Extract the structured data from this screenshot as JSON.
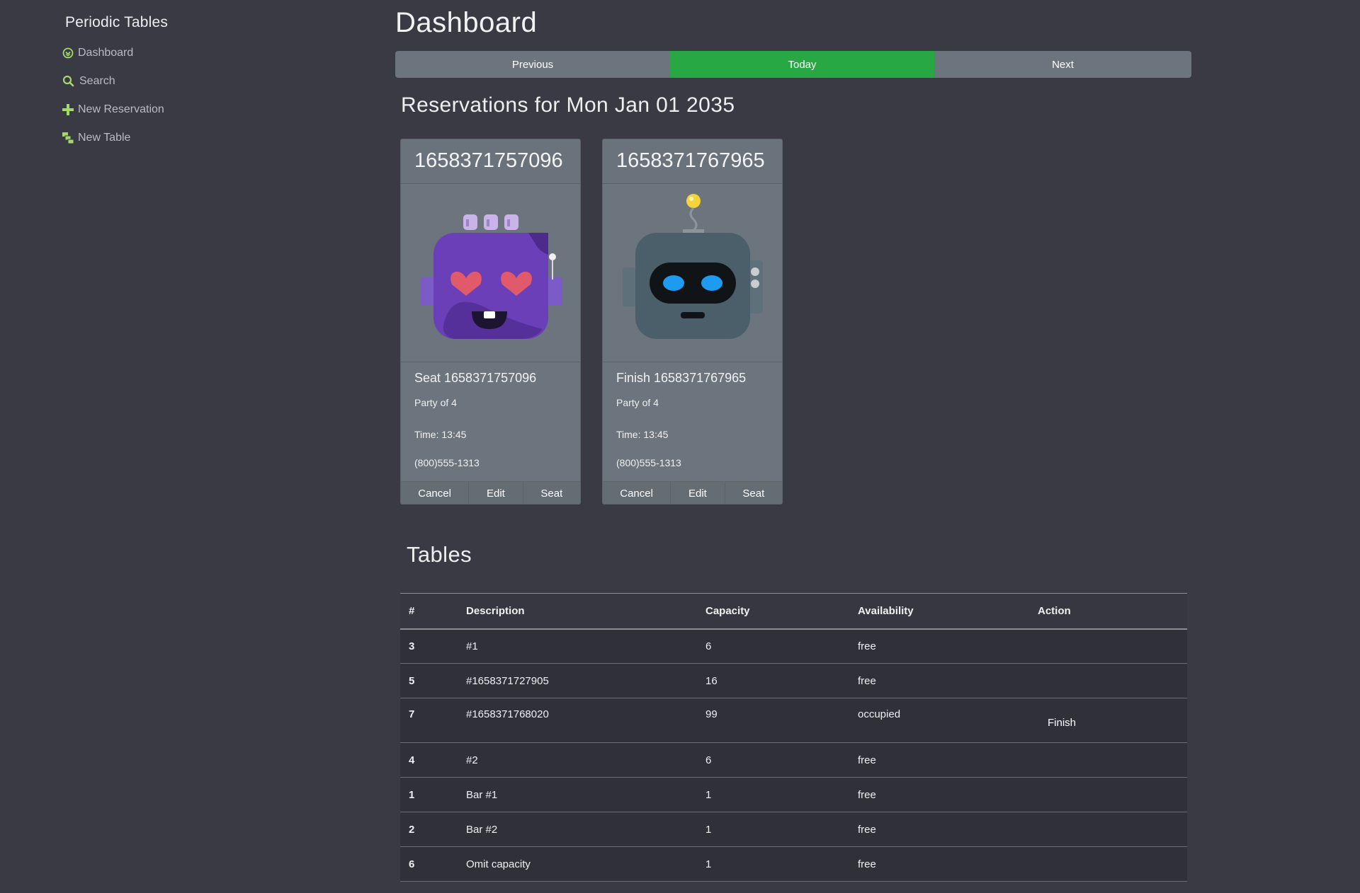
{
  "sidebar": {
    "brand": "Periodic Tables",
    "items": [
      {
        "label": "Dashboard",
        "icon": "dashboard-icon"
      },
      {
        "label": "Search",
        "icon": "search-icon"
      },
      {
        "label": "New Reservation",
        "icon": "plus-icon"
      },
      {
        "label": "New Table",
        "icon": "layers-icon"
      }
    ],
    "icon_color": "#a3d96b"
  },
  "main": {
    "title": "Dashboard",
    "date_nav": {
      "previous": "Previous",
      "today": "Today",
      "next": "Next"
    },
    "reservations_title": "Reservations for Mon Jan 01 2035",
    "reservations": [
      {
        "id": "1658371757096",
        "avatar": "purple-heart-eyes-robot",
        "name": "Seat 1658371757096",
        "party": "Party of 4",
        "time": "Time: 13:45",
        "phone": "(800)555-1313",
        "actions": {
          "cancel": "Cancel",
          "edit": "Edit",
          "seat": "Seat"
        }
      },
      {
        "id": "1658371767965",
        "avatar": "gray-antenna-robot",
        "name": "Finish 1658371767965",
        "party": "Party of 4",
        "time": "Time: 13:45",
        "phone": "(800)555-1313",
        "actions": {
          "cancel": "Cancel",
          "edit": "Edit",
          "seat": "Seat"
        }
      }
    ],
    "tables_title": "Tables",
    "tables": {
      "headers": [
        "#",
        "Description",
        "Capacity",
        "Availability",
        "Action"
      ],
      "rows": [
        {
          "num": "3",
          "desc": "#1",
          "cap": "6",
          "avail": "free",
          "action": ""
        },
        {
          "num": "5",
          "desc": "#1658371727905",
          "cap": "16",
          "avail": "free",
          "action": ""
        },
        {
          "num": "7",
          "desc": "#1658371768020",
          "cap": "99",
          "avail": "occupied",
          "action": "Finish"
        },
        {
          "num": "4",
          "desc": "#2",
          "cap": "6",
          "avail": "free",
          "action": ""
        },
        {
          "num": "1",
          "desc": "Bar #1",
          "cap": "1",
          "avail": "free",
          "action": ""
        },
        {
          "num": "2",
          "desc": "Bar #2",
          "cap": "1",
          "avail": "free",
          "action": ""
        },
        {
          "num": "6",
          "desc": "Omit capacity",
          "cap": "1",
          "avail": "free",
          "action": ""
        }
      ]
    },
    "colors": {
      "background": "#393a43",
      "secondary": "#6c757d",
      "success": "#28a745"
    }
  }
}
